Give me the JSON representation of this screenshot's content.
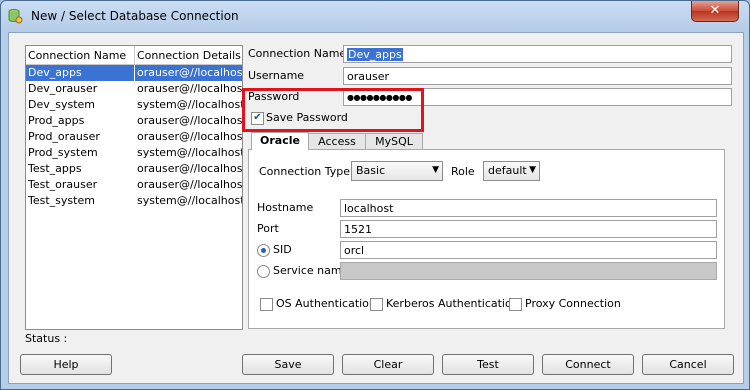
{
  "window": {
    "title": "New / Select Database Connection",
    "close_label": "✕"
  },
  "list": {
    "headers": [
      "Connection Name",
      "Connection Details"
    ],
    "rows": [
      [
        "Dev_apps",
        "orauser@//localhost..."
      ],
      [
        "Dev_orauser",
        "orauser@//localhost..."
      ],
      [
        "Dev_system",
        "system@//localhost..."
      ],
      [
        "Prod_apps",
        "orauser@//localhost..."
      ],
      [
        "Prod_orauser",
        "orauser@//localhost..."
      ],
      [
        "Prod_system",
        "system@//localhost..."
      ],
      [
        "Test_apps",
        "orauser@//localhost..."
      ],
      [
        "Test_orauser",
        "orauser@//localhost..."
      ],
      [
        "Test_system",
        "system@//localhost..."
      ]
    ],
    "selected": 0
  },
  "form": {
    "conn_name_label": "Connection Name",
    "conn_name_value": "Dev_apps",
    "username_label": "Username",
    "username_value": "orauser",
    "password_label": "Password",
    "password_value": "●●●●●●●●●●",
    "save_password_label": "Save Password",
    "save_password_checked": true
  },
  "tabs": [
    "Oracle",
    "Access",
    "MySQL"
  ],
  "oracle": {
    "conn_type_label": "Connection Type",
    "conn_type_value": "Basic",
    "role_label": "Role",
    "role_value": "default",
    "hostname_label": "Hostname",
    "hostname_value": "localhost",
    "port_label": "Port",
    "port_value": "1521",
    "sid_label": "SID",
    "sid_value": "orcl",
    "service_label": "Service name",
    "os_auth": "OS Authentication",
    "kerberos_auth": "Kerberos Authentication",
    "proxy_conn": "Proxy Connection"
  },
  "status_label": "Status :",
  "buttons": {
    "help": "Help",
    "save": "Save",
    "clear": "Clear",
    "test": "Test",
    "connect": "Connect",
    "cancel": "Cancel"
  },
  "colors": {
    "selection": "#3a73d3",
    "highlight_box": "#e0141e",
    "title_bar": "#b6cde8"
  }
}
